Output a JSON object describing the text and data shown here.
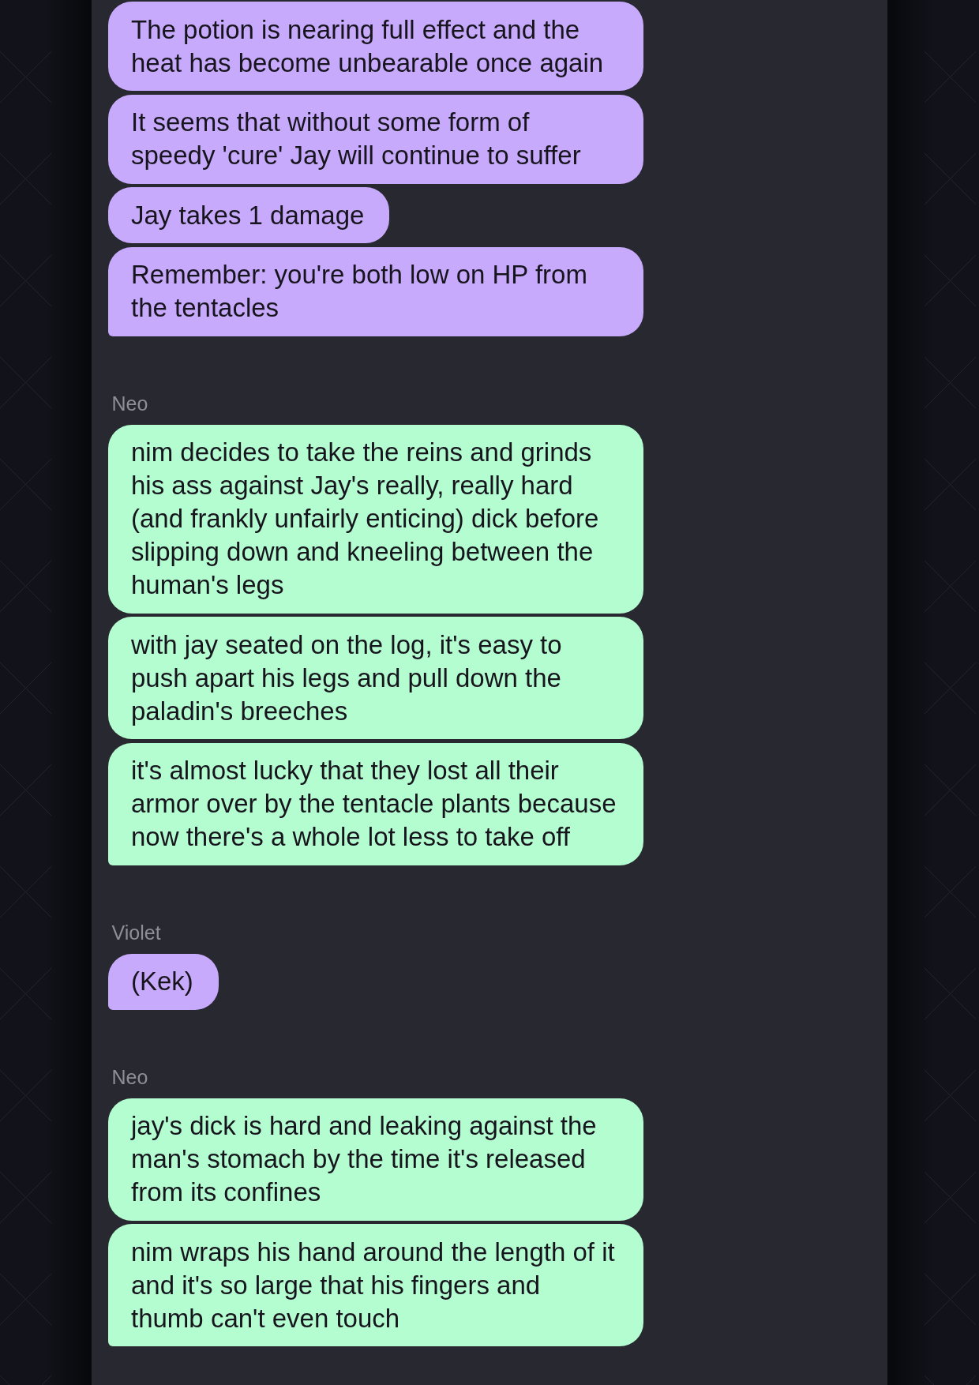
{
  "conversation": [
    {
      "color": "#c8aafd",
      "messages": [
        "The potion is nearing full effect and the heat has become unbearable once again",
        "It seems that without some form of speedy 'cure' Jay will continue to suffer",
        "Jay takes 1 damage",
        "Remember: you're both low on HP from the tentacles"
      ]
    },
    {
      "sender": "Neo",
      "color": "#b4fdd0",
      "messages": [
        "nim decides to take the reins and grinds his ass against Jay's really, really hard (and frankly unfairly enticing) dick before slipping down and kneeling between the human's legs",
        "with jay seated on the log, it's easy to push apart his legs and pull down the paladin's breeches",
        "it's almost lucky that they lost all their armor over by the tentacle plants because now there's a whole lot less to take off"
      ]
    },
    {
      "sender": "Violet",
      "color": "#c8aafd",
      "messages": [
        "(Kek)"
      ]
    },
    {
      "sender": "Neo",
      "color": "#b4fdd0",
      "messages": [
        "jay's dick is hard and leaking against the man's stomach by the time it's released from its confines",
        "nim wraps his hand around the length of it and it's so large that his fingers and thumb can't even touch"
      ]
    }
  ]
}
